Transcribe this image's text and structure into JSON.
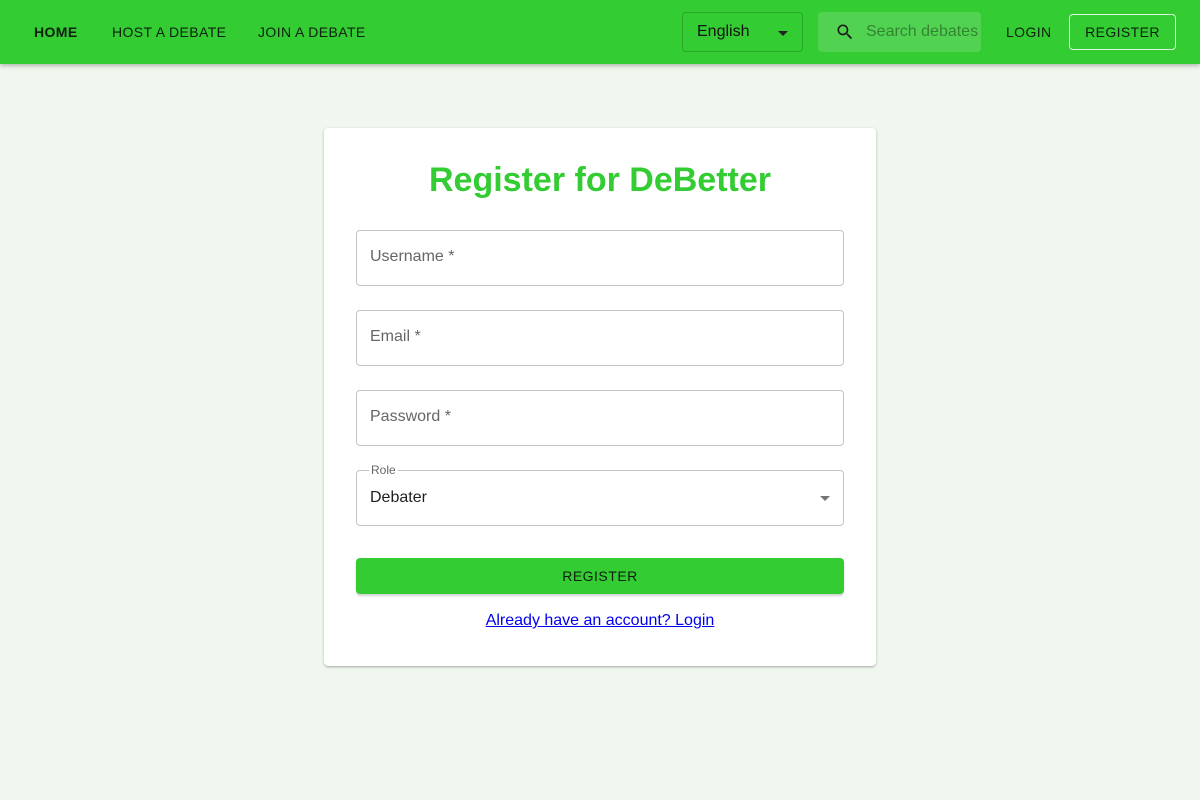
{
  "appbar": {
    "nav": [
      {
        "label": "HOME"
      },
      {
        "label": "HOST A DEBATE"
      },
      {
        "label": "JOIN A DEBATE"
      }
    ],
    "language": {
      "selected": "English"
    },
    "search": {
      "placeholder": "Search debates"
    },
    "login_label": "LOGIN",
    "register_label": "REGISTER"
  },
  "form": {
    "title": "Register for DeBetter",
    "username_label": "Username *",
    "email_label": "Email *",
    "password_label": "Password *",
    "role_label": "Role",
    "role_value": "Debater",
    "submit_label": "REGISTER",
    "login_link": "Already have an account? Login"
  },
  "colors": {
    "brand": "#33cc33",
    "background": "#eff7ee",
    "link": "#0000ee"
  },
  "icons": {
    "search": "search-icon",
    "dropdown": "chevron-down-icon"
  }
}
